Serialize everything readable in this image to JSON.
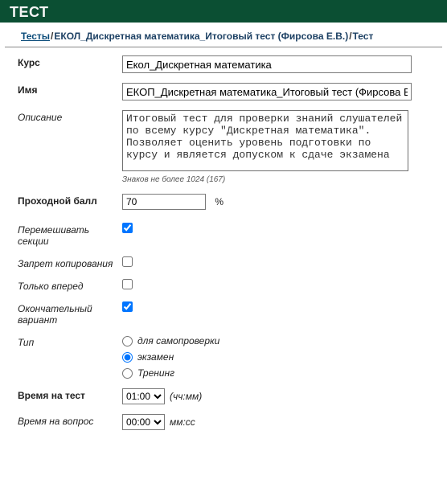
{
  "header": {
    "title": "Тест"
  },
  "breadcrumb": {
    "root": "Тесты",
    "path1": "ЕКОЛ_Дискретная математика_Итоговый тест (Фирсова Е.В.)",
    "path2": "Тест"
  },
  "form": {
    "course": {
      "label": "Курс",
      "value": "Екол_Дискретная математика"
    },
    "name": {
      "label": "Имя",
      "value": "ЕКОП_Дискретная математика_Итоговый тест (Фирсова Е."
    },
    "description": {
      "label": "Описание",
      "value": "Итоговый тест для проверки знаний слушателей по всему курсу \"Дискретная математика\". Позволяет оценить уровень подготовки по курсу и является допуском к сдаче экзамена",
      "hint": "Знаков не более 1024 (167)"
    },
    "pass_score": {
      "label": "Проходной балл",
      "value": "70",
      "suffix": "%"
    },
    "shuffle_sections": {
      "label": "Перемешивать секции",
      "checked": true
    },
    "no_copy": {
      "label": "Запрет копирования",
      "checked": false
    },
    "forward_only": {
      "label": "Только вперед",
      "checked": false
    },
    "final_variant": {
      "label": "Окончательный вариант",
      "checked": true
    },
    "type": {
      "label": "Тип",
      "options": [
        {
          "label": "для самопроверки",
          "value": "self",
          "checked": false
        },
        {
          "label": "экзамен",
          "value": "exam",
          "checked": true
        },
        {
          "label": "Тренинг",
          "value": "train",
          "checked": false
        }
      ]
    },
    "test_time": {
      "label": "Время на тест",
      "value": "01:00",
      "suffix": "(чч:мм)"
    },
    "question_time": {
      "label": "Время на вопрос",
      "value": "00:00",
      "suffix": "мм:сс"
    }
  }
}
